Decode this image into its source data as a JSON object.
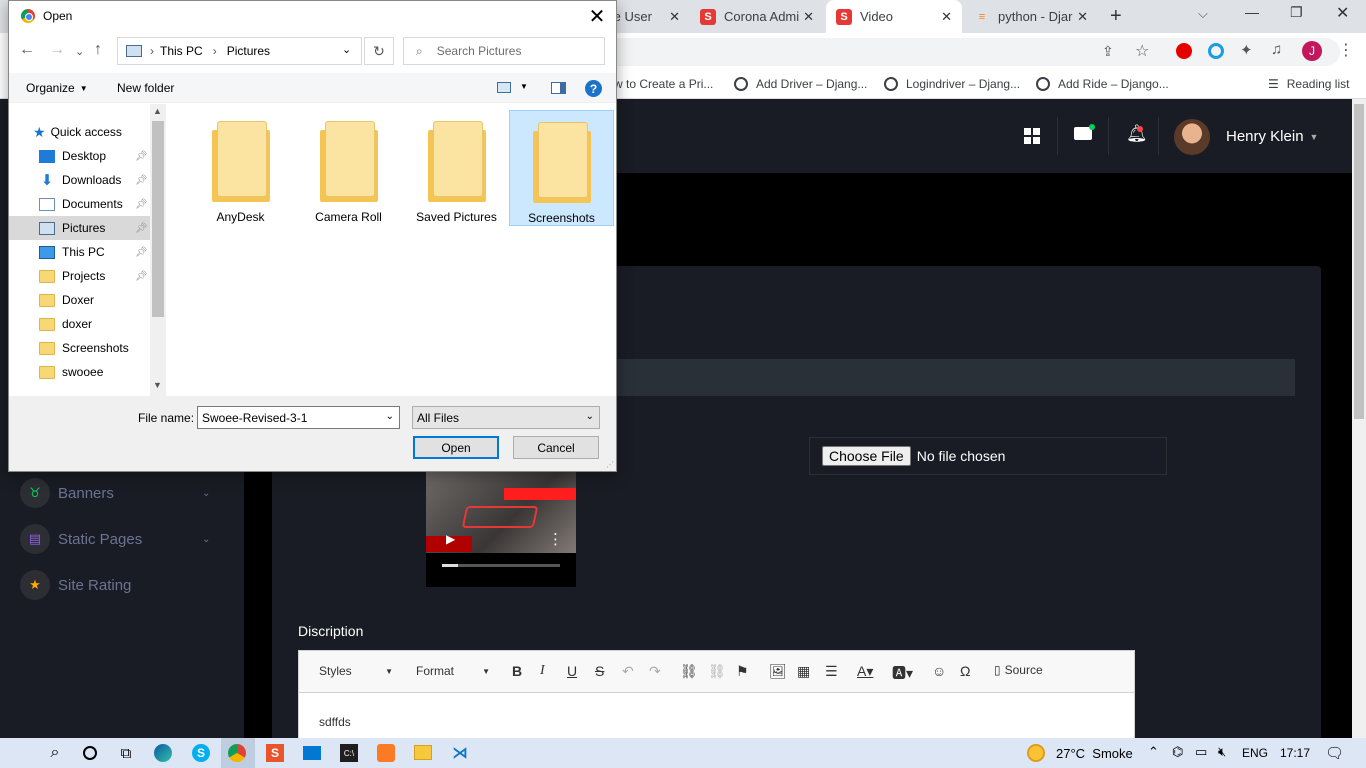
{
  "browser": {
    "tabs": [
      {
        "label": "te User",
        "icon": "page-icon"
      },
      {
        "label": "Corona Admi",
        "icon": "swoee-logo-icon"
      },
      {
        "label": "Video",
        "icon": "swoee-logo-icon",
        "active": true
      },
      {
        "label": "python - Djar",
        "icon": "stackoverflow-icon"
      }
    ],
    "bookmarks": [
      "w to Create a Pri...",
      "Add Driver – Djang...",
      "Logindriver – Djang...",
      "Add Ride – Django..."
    ],
    "reading_list": "Reading list",
    "profile_letter": "J"
  },
  "navbar": {
    "user_name": "Henry Klein"
  },
  "sidebar": {
    "items": [
      {
        "label": "Banners",
        "icon": "banner-icon"
      },
      {
        "label": "Static Pages",
        "icon": "document-icon"
      },
      {
        "label": "Site Rating",
        "icon": "star-icon"
      }
    ]
  },
  "form": {
    "choose_file_button": "Choose File",
    "file_status": "No file chosen",
    "description_label": "Discription",
    "editor": {
      "styles": "Styles",
      "format": "Format",
      "source": "Source",
      "content": "sdffds"
    }
  },
  "dialog": {
    "title": "Open",
    "breadcrumb": [
      "This PC",
      "Pictures"
    ],
    "search_placeholder": "Search Pictures",
    "organize": "Organize",
    "new_folder": "New folder",
    "tree": [
      {
        "label": "Quick access",
        "icon": "star-icon"
      },
      {
        "label": "Desktop",
        "icon": "desktop-icon",
        "pinned": true
      },
      {
        "label": "Downloads",
        "icon": "download-icon",
        "pinned": true
      },
      {
        "label": "Documents",
        "icon": "documents-icon",
        "pinned": true
      },
      {
        "label": "Pictures",
        "icon": "pictures-icon",
        "pinned": true,
        "selected": true
      },
      {
        "label": "This PC",
        "icon": "computer-icon",
        "pinned": true
      },
      {
        "label": "Projects",
        "icon": "folder-icon",
        "pinned": true
      },
      {
        "label": "Doxer",
        "icon": "folder-icon"
      },
      {
        "label": "doxer",
        "icon": "folder-icon"
      },
      {
        "label": "Screenshots",
        "icon": "folder-icon"
      },
      {
        "label": "swooee",
        "icon": "folder-icon"
      }
    ],
    "files": [
      {
        "label": "AnyDesk"
      },
      {
        "label": "Camera Roll"
      },
      {
        "label": "Saved Pictures"
      },
      {
        "label": "Screenshots",
        "selected": true
      }
    ],
    "file_name_label": "File name:",
    "file_name_value": "Swoee-Revised-3-1",
    "file_type": "All Files",
    "open_button": "Open",
    "cancel_button": "Cancel"
  },
  "taskbar": {
    "weather": "27°C  Smoke",
    "language": "ENG",
    "time": "17:17"
  },
  "colors": {
    "admin_bg": "#191c24",
    "dialog_selection": "#cce8ff",
    "chrome_tabbar": "#dee1e6",
    "primary_blue": "#0078d7"
  }
}
